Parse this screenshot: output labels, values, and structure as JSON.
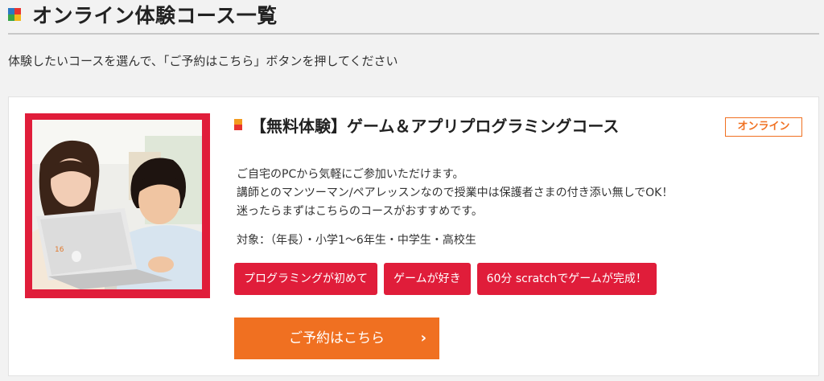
{
  "header": {
    "title": "オンライン体験コース一覧",
    "logo_colors": [
      "#2b79c2",
      "#e8332f",
      "#37a547",
      "#f3b81c"
    ]
  },
  "intro": "体験したいコースを選んで、「ご予約はこちら」ボタンを押してください",
  "course": {
    "title": "【無料体験】ゲーム＆アプリプログラミングコース",
    "badge": "オンライン",
    "description": [
      "ご自宅のPCから気軽にご参加いただけます。",
      "講師とのマンツーマン/ペアレッスンなので授業中は保護者さまの付き添い無しでOK！",
      "迷ったらまずはこちらのコースがおすすめです。"
    ],
    "target": "対象：（年長）・小学1〜6年生・中学生・高校生",
    "tags": [
      "プログラミングが初めて",
      "ゲームが好き",
      "60分 scratchでゲームが完成！"
    ],
    "laptop_sticker": "16",
    "reserve_label": "ご予約はこちら",
    "reserve_icon": "chevron-right-icon"
  },
  "colors": {
    "accent_red": "#e01d3a",
    "accent_orange": "#f07021",
    "background": "#f2f2f2"
  }
}
